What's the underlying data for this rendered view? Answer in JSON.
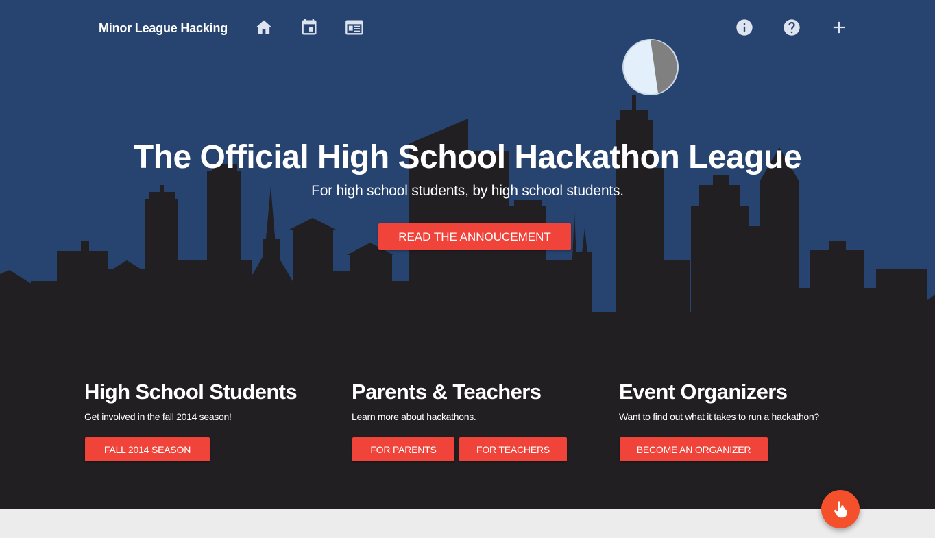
{
  "nav": {
    "brand": "Minor League Hacking",
    "icons": [
      "home-icon",
      "calendar-icon",
      "schedule-icon",
      "info-icon",
      "help-icon",
      "add-icon"
    ]
  },
  "hero": {
    "headline": "The Official High School Hackathon League",
    "tagline": "For high school students, by high school students.",
    "cta_label": "READ THE ANNOUCEMENT"
  },
  "sections": [
    {
      "title": "High School Students",
      "text": "Get involved in the fall 2014 season!",
      "buttons": [
        "FALL 2014 SEASON"
      ]
    },
    {
      "title": "Parents & Teachers",
      "text": "Learn more about hackathons.",
      "buttons": [
        "FOR PARENTS",
        "FOR TEACHERS"
      ]
    },
    {
      "title": "Event Organizers",
      "text": "Want to find out what it takes to run a hackathon?",
      "buttons": [
        "BECOME AN ORGANIZER"
      ]
    }
  ],
  "fab": {
    "icon": "hand-pointer-icon"
  },
  "colors": {
    "sky": "#27436f",
    "skyline": "#211f22",
    "accent": "#f0433a",
    "fab": "#f4502c",
    "moon": "#e3f0fc",
    "moon_shadow": "#808080",
    "footer": "#ececec"
  }
}
